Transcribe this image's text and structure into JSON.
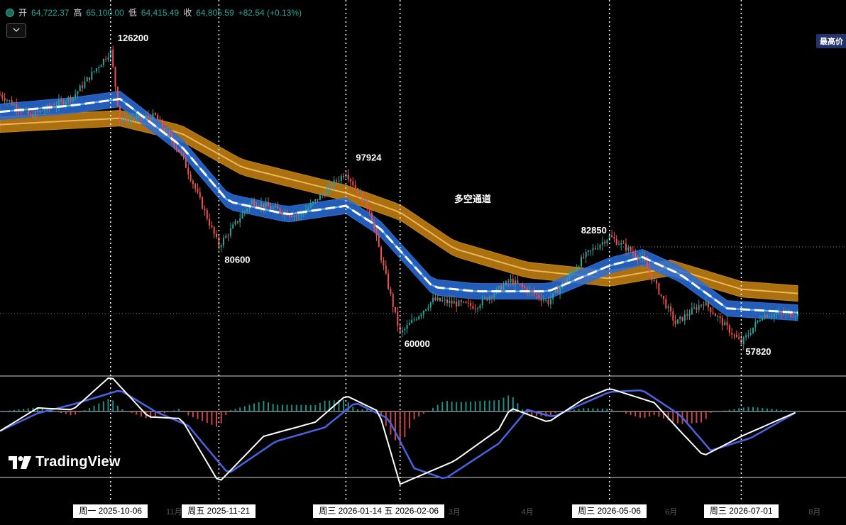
{
  "ohlc": {
    "open_label": "开",
    "open": "64,722.37",
    "high_label": "高",
    "high": "65,100.00",
    "low_label": "低",
    "low": "64,415.49",
    "close_label": "收",
    "close": "64,805.59",
    "change": "+82.54 (+0.13%)"
  },
  "collapse_icon": "chevron-down-icon",
  "price_badge": "最高价",
  "brand": "TradingView",
  "colors": {
    "up": "#26a69a",
    "down": "#ef5350",
    "blue_band": "#2a6dd8",
    "orange_band": "#c98412",
    "macd_line": "#ffffff",
    "signal_line": "#4a63e0"
  },
  "chart_data": [
    {
      "type": "candlestick",
      "title": "",
      "annotations": [
        {
          "text": "126200",
          "kind": "high"
        },
        {
          "text": "80600",
          "kind": "low"
        },
        {
          "text": "97924",
          "kind": "high"
        },
        {
          "text": "60000",
          "kind": "low"
        },
        {
          "text": "82850",
          "kind": "high"
        },
        {
          "text": "57820",
          "kind": "low"
        },
        {
          "text": "多空通道",
          "kind": "label"
        }
      ],
      "price_path": [
        {
          "d": "2025-08-20",
          "p": 116000
        },
        {
          "d": "2025-09-02",
          "p": 111000
        },
        {
          "d": "2025-09-20",
          "p": 115500
        },
        {
          "d": "2025-10-06",
          "p": 126200
        },
        {
          "d": "2025-10-10",
          "p": 110000
        },
        {
          "d": "2025-10-25",
          "p": 111000
        },
        {
          "d": "2025-11-05",
          "p": 102000
        },
        {
          "d": "2025-11-21",
          "p": 80600
        },
        {
          "d": "2025-12-05",
          "p": 91000
        },
        {
          "d": "2025-12-25",
          "p": 87500
        },
        {
          "d": "2026-01-14",
          "p": 97924
        },
        {
          "d": "2026-01-24",
          "p": 89000
        },
        {
          "d": "2026-02-06",
          "p": 60000
        },
        {
          "d": "2026-02-20",
          "p": 68000
        },
        {
          "d": "2026-03-10",
          "p": 66500
        },
        {
          "d": "2026-03-25",
          "p": 72500
        },
        {
          "d": "2026-04-10",
          "p": 67500
        },
        {
          "d": "2026-04-25",
          "p": 78000
        },
        {
          "d": "2026-05-06",
          "p": 82850
        },
        {
          "d": "2026-05-20",
          "p": 77500
        },
        {
          "d": "2026-06-03",
          "p": 62500
        },
        {
          "d": "2026-06-15",
          "p": 67500
        },
        {
          "d": "2026-07-01",
          "p": 57820
        },
        {
          "d": "2026-07-10",
          "p": 64500
        },
        {
          "d": "2026-07-25",
          "p": 64805
        }
      ],
      "blue_band_path": [
        {
          "d": "2025-08-20",
          "p": 112000
        },
        {
          "d": "2025-09-20",
          "p": 113500
        },
        {
          "d": "2025-10-10",
          "p": 115000
        },
        {
          "d": "2025-11-05",
          "p": 104000
        },
        {
          "d": "2025-11-25",
          "p": 91000
        },
        {
          "d": "2025-12-20",
          "p": 88000
        },
        {
          "d": "2026-01-14",
          "p": 90000
        },
        {
          "d": "2026-01-28",
          "p": 85000
        },
        {
          "d": "2026-02-20",
          "p": 71000
        },
        {
          "d": "2026-03-10",
          "p": 70000
        },
        {
          "d": "2026-04-10",
          "p": 70000
        },
        {
          "d": "2026-05-06",
          "p": 76000
        },
        {
          "d": "2026-05-20",
          "p": 78000
        },
        {
          "d": "2026-06-05",
          "p": 74000
        },
        {
          "d": "2026-06-25",
          "p": 66000
        },
        {
          "d": "2026-07-25",
          "p": 65000
        }
      ],
      "orange_band_path": [
        {
          "d": "2025-08-20",
          "p": 109000
        },
        {
          "d": "2025-10-10",
          "p": 110500
        },
        {
          "d": "2025-11-05",
          "p": 107000
        },
        {
          "d": "2025-12-01",
          "p": 99000
        },
        {
          "d": "2026-01-14",
          "p": 93000
        },
        {
          "d": "2026-02-06",
          "p": 88500
        },
        {
          "d": "2026-03-01",
          "p": 80000
        },
        {
          "d": "2026-04-01",
          "p": 75000
        },
        {
          "d": "2026-05-06",
          "p": 73000
        },
        {
          "d": "2026-06-01",
          "p": 75500
        },
        {
          "d": "2026-07-01",
          "p": 70500
        },
        {
          "d": "2026-07-25",
          "p": 69500
        }
      ]
    },
    {
      "type": "macd",
      "macd_path": [
        {
          "d": "2025-08-20",
          "v": -0.55
        },
        {
          "d": "2025-09-05",
          "v": 0.1
        },
        {
          "d": "2025-09-20",
          "v": 0.05
        },
        {
          "d": "2025-10-06",
          "v": 1.0
        },
        {
          "d": "2025-10-22",
          "v": -0.15
        },
        {
          "d": "2025-11-05",
          "v": -0.2
        },
        {
          "d": "2025-11-21",
          "v": -2.0
        },
        {
          "d": "2025-12-10",
          "v": -0.7
        },
        {
          "d": "2026-01-01",
          "v": -0.3
        },
        {
          "d": "2026-01-14",
          "v": 0.45
        },
        {
          "d": "2026-01-28",
          "v": 0.0
        },
        {
          "d": "2026-02-06",
          "v": -2.05
        },
        {
          "d": "2026-03-01",
          "v": -1.4
        },
        {
          "d": "2026-03-20",
          "v": -0.5
        },
        {
          "d": "2026-03-25",
          "v": 0.1
        },
        {
          "d": "2026-04-10",
          "v": -0.3
        },
        {
          "d": "2026-04-25",
          "v": 0.35
        },
        {
          "d": "2026-05-06",
          "v": 0.65
        },
        {
          "d": "2026-05-25",
          "v": 0.25
        },
        {
          "d": "2026-06-05",
          "v": -0.55
        },
        {
          "d": "2026-06-15",
          "v": -1.25
        },
        {
          "d": "2026-07-01",
          "v": -0.7
        },
        {
          "d": "2026-07-25",
          "v": 0.0
        }
      ],
      "signal_path": [
        {
          "d": "2025-08-20",
          "v": -0.55
        },
        {
          "d": "2025-09-05",
          "v": -0.05
        },
        {
          "d": "2025-09-20",
          "v": 0.2
        },
        {
          "d": "2025-10-10",
          "v": 0.6
        },
        {
          "d": "2025-10-25",
          "v": 0.0
        },
        {
          "d": "2025-11-08",
          "v": -0.4
        },
        {
          "d": "2025-11-25",
          "v": -1.75
        },
        {
          "d": "2025-12-15",
          "v": -0.85
        },
        {
          "d": "2026-01-05",
          "v": -0.45
        },
        {
          "d": "2026-01-18",
          "v": 0.25
        },
        {
          "d": "2026-02-01",
          "v": -0.2
        },
        {
          "d": "2026-02-12",
          "v": -1.6
        },
        {
          "d": "2026-02-25",
          "v": -1.9
        },
        {
          "d": "2026-03-20",
          "v": -0.9
        },
        {
          "d": "2026-04-01",
          "v": 0.05
        },
        {
          "d": "2026-04-12",
          "v": -0.15
        },
        {
          "d": "2026-05-06",
          "v": 0.55
        },
        {
          "d": "2026-05-20",
          "v": 0.6
        },
        {
          "d": "2026-06-05",
          "v": -0.1
        },
        {
          "d": "2026-06-18",
          "v": -1.1
        },
        {
          "d": "2026-07-05",
          "v": -0.75
        },
        {
          "d": "2026-07-25",
          "v": 0.0
        }
      ],
      "histogram_note": "bars = macd - signal"
    }
  ],
  "markers": {
    "vertical_dates": [
      "2025-10-06",
      "2025-11-21",
      "2026-01-14",
      "2026-02-06",
      "2026-05-06",
      "2026-07-01"
    ]
  },
  "x_axis": {
    "labels": [
      {
        "text": "周一 2025-10-06",
        "d": "2025-10-06"
      },
      {
        "text": "周五 2025-11-21",
        "d": "2025-11-21"
      },
      {
        "text": "周三 2026-01-14 五 2026-02-06",
        "d": "2026-01-28"
      },
      {
        "text": "周三 2026-05-06",
        "d": "2026-05-06"
      },
      {
        "text": "周三 2026-07-01",
        "d": "2026-07-01"
      }
    ],
    "faint_ticks": [
      {
        "text": "11月",
        "d": "2025-11-01"
      },
      {
        "text": "3月",
        "d": "2026-03-01"
      },
      {
        "text": "4月",
        "d": "2026-04-01"
      },
      {
        "text": "6月",
        "d": "2026-06-01"
      },
      {
        "text": "8月",
        "d": "2026-08-01"
      }
    ]
  }
}
